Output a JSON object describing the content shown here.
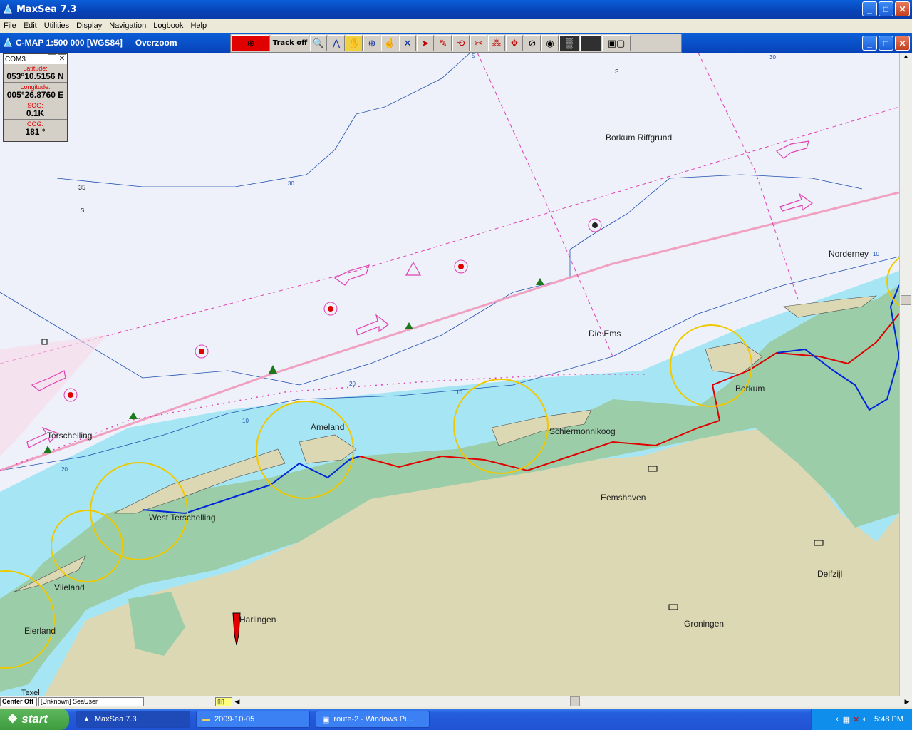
{
  "app": {
    "title": "MaxSea 7.3"
  },
  "menu": [
    "File",
    "Edit",
    "Utilities",
    "Display",
    "Navigation",
    "Logbook",
    "Help"
  ],
  "chart_window": {
    "title": "C-MAP  1:500 000 [WGS84]",
    "zoom_state": "Overzoom"
  },
  "toolbar": {
    "track_label": "Track off"
  },
  "info_panel": {
    "port": "COM3",
    "latitude_label": "Latitude:",
    "latitude": "053°10.5156 N",
    "longitude_label": "Longitude:",
    "longitude": "005°26.8760 E",
    "sog_label": "SOG:",
    "sog": "0.1K",
    "cog_label": "COG:",
    "cog": "181 °"
  },
  "map_labels": {
    "borkum_riffgrund": "Borkum Riffgrund",
    "norderney": "Norderney",
    "die_ems": "Die Ems",
    "borkum": "Borkum",
    "ameland": "Ameland",
    "schiermonnikoog": "Schiermonnikoog",
    "terschelling": "Terschelling",
    "west_terschelling": "West Terschelling",
    "eemshaven": "Eemshaven",
    "vlieland": "Vlieland",
    "eierland": "Eierland",
    "harlingen": "Harlingen",
    "delfzijl": "Delfzijl",
    "groningen": "Groningen",
    "texel": "Texel",
    "depth_35": "35",
    "depth_30a": "30",
    "depth_30b": "30",
    "depth_20a": "20",
    "depth_20b": "20",
    "depth_10a": "10",
    "depth_10b": "10",
    "depth_10c": "10",
    "depth_5": "5",
    "soundings_s1": "S",
    "soundings_s2": "S"
  },
  "statusbar": {
    "center": "Center Off",
    "user": "[Unknown]  SeaUser"
  },
  "taskbar": {
    "start": "start",
    "tasks": [
      "MaxSea 7.3",
      "2009-10-05",
      "route-2 - Windows Pi..."
    ],
    "clock": "5:48 PM"
  },
  "colors": {
    "land": "#DDD8B4",
    "shallow": "#A6E6F4",
    "island": "#9ACDA8",
    "sea": "#EEF1FA",
    "route_blue": "#0026D8",
    "route_red": "#E00000",
    "circle": "#F0C800"
  }
}
